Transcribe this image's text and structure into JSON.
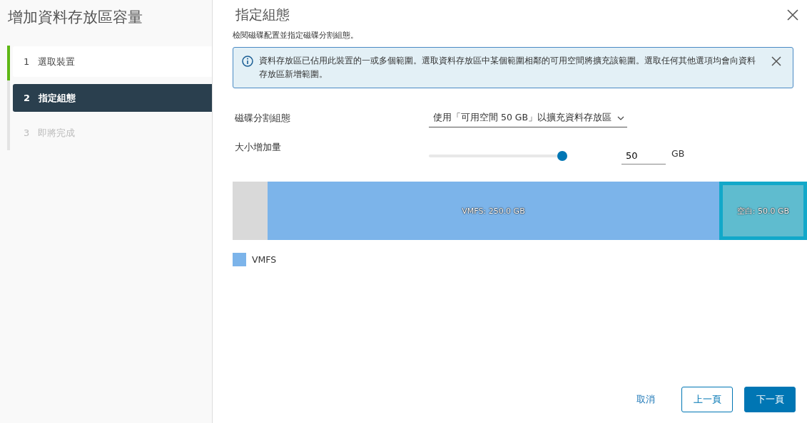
{
  "sidebar": {
    "title": "增加資料存放區容量",
    "steps": [
      {
        "number": "1",
        "label": "選取裝置",
        "completed": true,
        "selected": false,
        "disabled": false
      },
      {
        "number": "2",
        "label": "指定組態",
        "completed": false,
        "selected": true,
        "disabled": false
      },
      {
        "number": "3",
        "label": "即將完成",
        "completed": false,
        "selected": false,
        "disabled": true
      }
    ]
  },
  "main": {
    "title": "指定組態",
    "subtitle": "檢閱磁碟配置並指定磁碟分割組態。",
    "alert": {
      "text": "資料存放區已佔用此裝置的一或多個範圍。選取資料存放區中某個範圍相鄰的可用空間將擴充該範圍。選取任何其他選項均會向資料存放區新增範圍。"
    },
    "partition": {
      "label": "磁碟分割組態",
      "value": "使用「可用空間 50 GB」以擴充資料存放區"
    },
    "size": {
      "label": "大小增加量",
      "level": 1.0,
      "value": "50",
      "unit": "GB"
    },
    "disk_segments": [
      {
        "kind": "used",
        "selected": false
      },
      {
        "kind": "vmfs",
        "label": "VMFS: 250.0 GB",
        "selected": false
      },
      {
        "kind": "free",
        "label": "空白: 50.0 GB",
        "selected": true
      }
    ],
    "legend": [
      {
        "label": "VMFS",
        "color": "#7cb4ea"
      }
    ],
    "buttons": {
      "cancel": "取消",
      "back": "上一頁",
      "next": "下一頁"
    }
  }
}
